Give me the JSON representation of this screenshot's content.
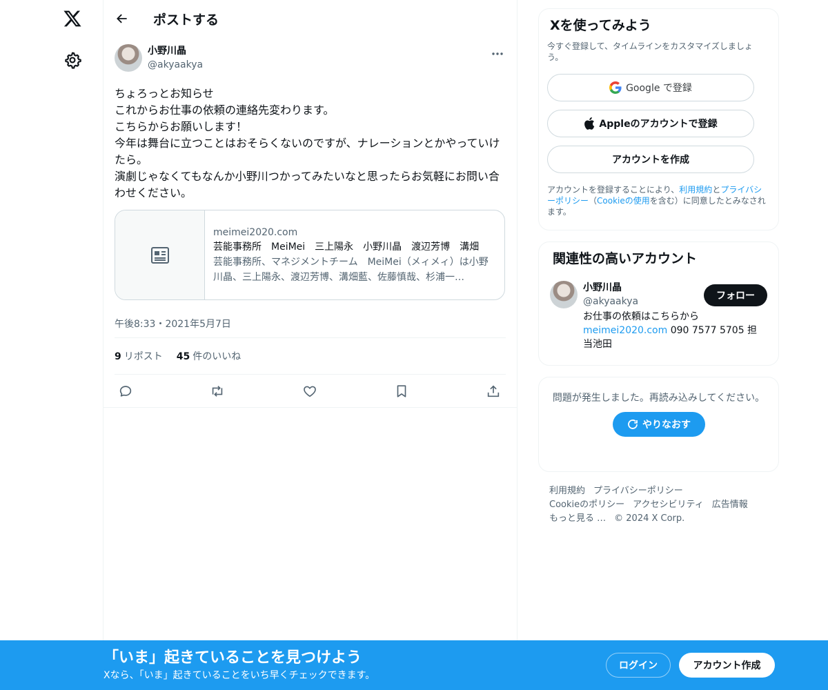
{
  "header": {
    "title": "ポストする"
  },
  "post": {
    "author_name": "小野川晶",
    "author_handle": "@akyaakya",
    "body": "ちょろっとお知らせ\nこれからお仕事の依頼の連絡先変わります。\nこちらからお願いします！\n今年は舞台に立つことはおそらくないのですが、ナレーションとかやっていけたら。\n演劇じゃなくてもなんか小野川つかってみたいなと思ったらお気軽にお問い合わせください。",
    "card": {
      "domain": "meimei2020.com",
      "title": "芸能事務所　MeiMei　三上陽永　小野川晶　渡辺芳博　溝畑",
      "description": "芸能事務所、マネジメントチーム　MeiMei（メィメィ）は小野川晶、三上陽永、渡辺芳博、溝畑藍、佐藤慎哉、杉浦一…"
    },
    "timestamp": "午後8:33・2021年5月7日",
    "reposts_count": "9",
    "reposts_label": "リポスト",
    "likes_count": "45",
    "likes_label": "件のいいね"
  },
  "signup": {
    "title": "Xを使ってみよう",
    "subtitle": "今すぐ登録して、タイムラインをカスタマイズしましょう。",
    "google_label": "Google で登録",
    "apple_label": "Appleのアカウントで登録",
    "create_label": "アカウントを作成",
    "legal_1": "アカウントを登録することにより、",
    "legal_terms": "利用規約",
    "legal_and": "と",
    "legal_privacy": "プライバシーポリシー",
    "legal_2": "（",
    "legal_cookie": "Cookieの使用",
    "legal_3": "を含む）に同意したとみなされます。"
  },
  "related": {
    "title": "関連性の高いアカウント",
    "name": "小野川晶",
    "handle": "@akyaakya",
    "follow_label": "フォロー",
    "bio_1": "お仕事の依頼はこちらから",
    "bio_link": "meimei2020.com",
    "bio_2": " 090 7577 5705 担当池田"
  },
  "error": {
    "message": "問題が発生しました。再読み込みしてください。",
    "retry_label": "やりなおす"
  },
  "footer": {
    "terms": "利用規約",
    "privacy": "プライバシーポリシー",
    "cookie": "Cookieのポリシー",
    "accessibility": "アクセシビリティ",
    "ads": "広告情報",
    "more": "もっと見る …",
    "copyright": "© 2024 X Corp."
  },
  "banner": {
    "title": "「いま」起きていることを見つけよう",
    "subtitle": "Xなら、「いま」起きていることをいち早くチェックできます。",
    "login_label": "ログイン",
    "signup_label": "アカウント作成"
  },
  "colors": {
    "accent": "#1d9bf0",
    "text": "#0f1419",
    "muted": "#536471",
    "border": "#eff3f4"
  },
  "icons": [
    "x-logo-icon",
    "gear-icon",
    "back-arrow-icon",
    "more-icon",
    "news-icon",
    "reply-icon",
    "repost-icon",
    "like-icon",
    "bookmark-icon",
    "share-icon",
    "google-icon",
    "apple-icon",
    "refresh-icon"
  ]
}
